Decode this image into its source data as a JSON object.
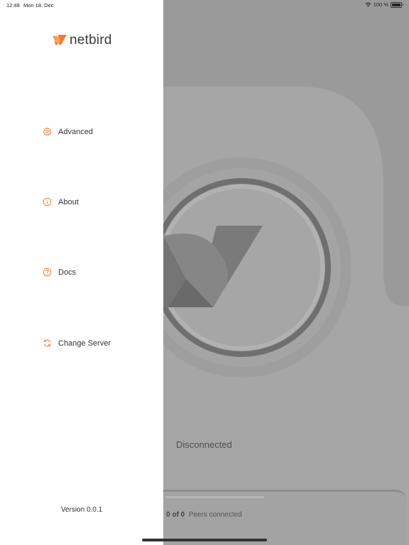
{
  "status_bar": {
    "time": "12:48",
    "date": "Mon 18. Dec",
    "battery": "100 %"
  },
  "drawer": {
    "brand": "netbird",
    "items": [
      {
        "label": "Advanced",
        "icon": "gear-icon"
      },
      {
        "label": "About",
        "icon": "info-icon"
      },
      {
        "label": "Docs",
        "icon": "question-icon"
      },
      {
        "label": "Change Server",
        "icon": "refresh-icon"
      }
    ],
    "version": "Version 0.0.1"
  },
  "main": {
    "connection_status": "Disconnected",
    "peers_count": "0 of 0",
    "peers_label": "Peers connected"
  },
  "colors": {
    "accent": "#f37b2f",
    "overlay": "#9a9a9a",
    "drawer_bg": "#ffffff"
  }
}
